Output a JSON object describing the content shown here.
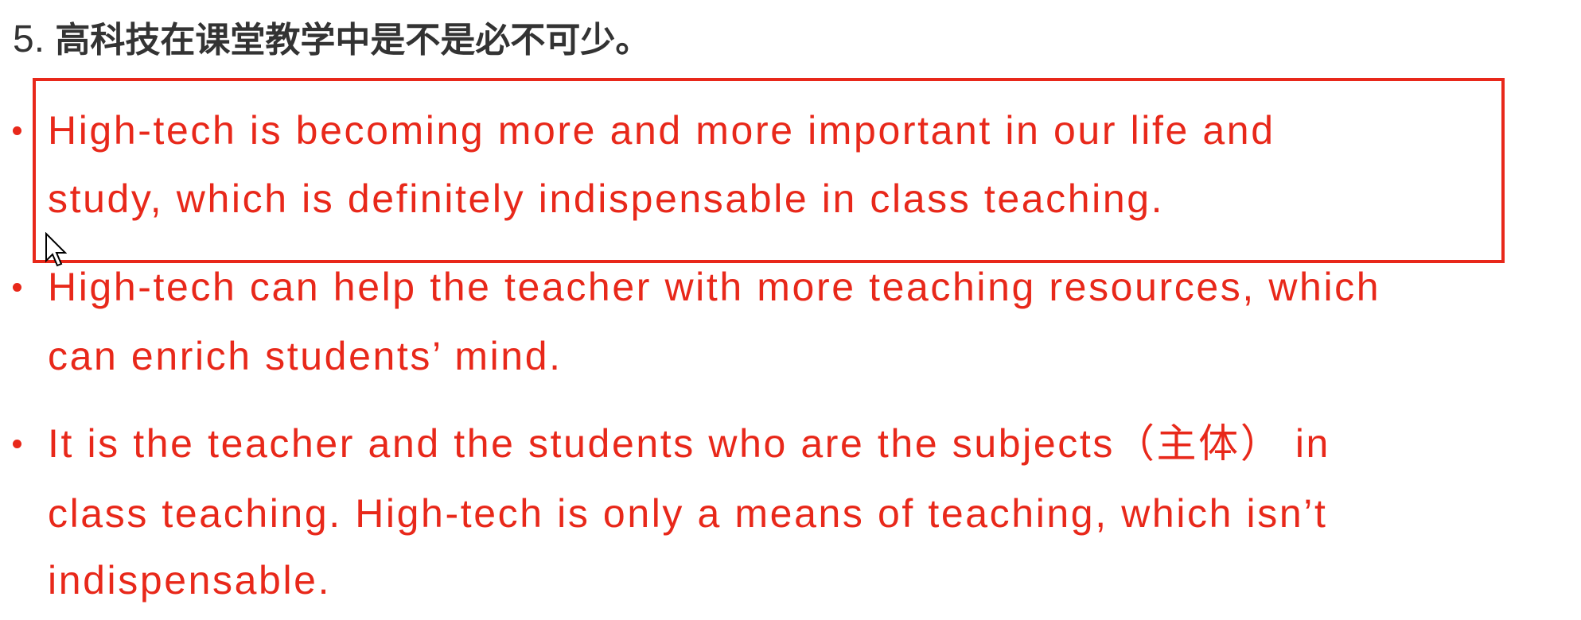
{
  "title": {
    "number": "5.",
    "question": "高科技在课堂教学中是不是必不可少。"
  },
  "points": [
    {
      "lines": [
        "High-tech is becoming more and more important in our life and",
        "study, which is definitely indispensable in class teaching."
      ]
    },
    {
      "lines": [
        "High-tech can help the teacher with more teaching resources, which",
        "can enrich students’ mind."
      ]
    },
    {
      "lines": [
        "It is the teacher and the students who are the subjects（主体） in",
        "class teaching. High-tech is only a means of teaching, which isn’t",
        "indispensable."
      ]
    }
  ],
  "colors": {
    "accent": "#e8281a",
    "title": "#333333"
  }
}
